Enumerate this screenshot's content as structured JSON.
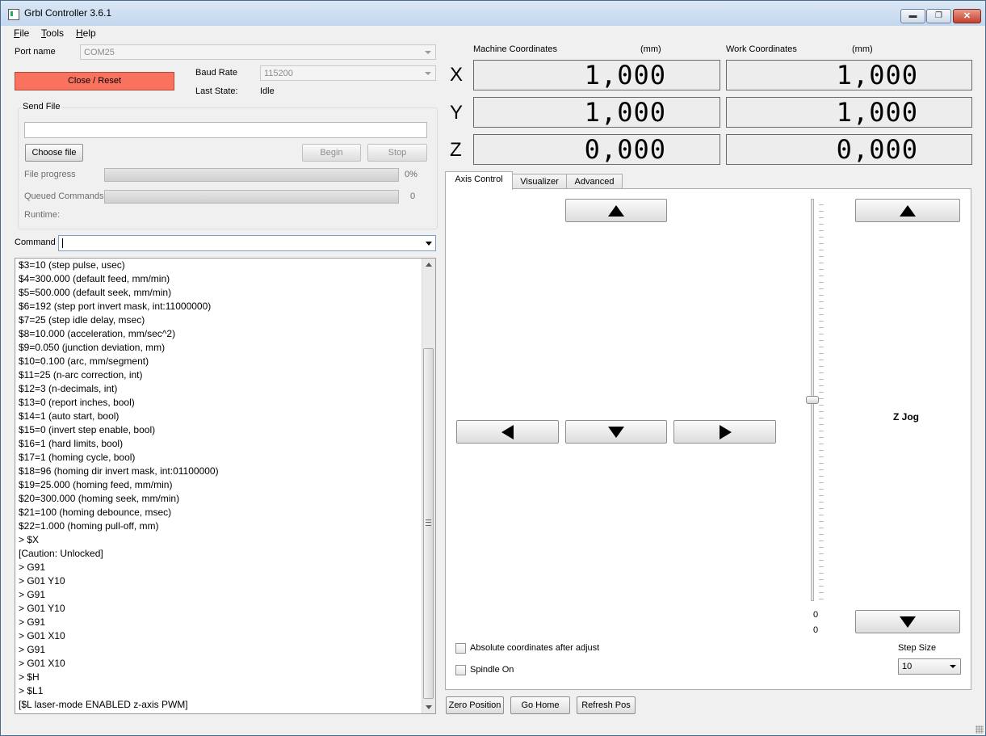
{
  "window": {
    "title": "Grbl Controller 3.6.1"
  },
  "menu": {
    "file": "File",
    "tools": "Tools",
    "help": "Help"
  },
  "connection": {
    "port_label": "Port name",
    "port_value": "COM25",
    "close_reset_label": "Close / Reset",
    "baud_label": "Baud Rate",
    "baud_value": "115200",
    "last_state_label": "Last State:",
    "last_state_value": "Idle"
  },
  "send_file": {
    "group_label": "Send File",
    "file_path": "",
    "choose_label": "Choose file",
    "begin_label": "Begin",
    "stop_label": "Stop",
    "progress_label": "File progress",
    "progress_value": "0%",
    "progress_fraction": 0,
    "queued_label": "Queued Commands",
    "queued_value": "0",
    "runtime_label": "Runtime:"
  },
  "command": {
    "label": "Command",
    "value": ""
  },
  "log": [
    "$3=10 (step pulse, usec)",
    "$4=300.000 (default feed, mm/min)",
    "$5=500.000 (default seek, mm/min)",
    "$6=192 (step port invert mask, int:11000000)",
    "$7=25 (step idle delay, msec)",
    "$8=10.000 (acceleration, mm/sec^2)",
    "$9=0.050 (junction deviation, mm)",
    "$10=0.100 (arc, mm/segment)",
    "$11=25 (n-arc correction, int)",
    "$12=3 (n-decimals, int)",
    "$13=0 (report inches, bool)",
    "$14=1 (auto start, bool)",
    "$15=0 (invert step enable, bool)",
    "$16=1 (hard limits, bool)",
    "$17=1 (homing cycle, bool)",
    "$18=96 (homing dir invert mask, int:01100000)",
    "$19=25.000 (homing feed, mm/min)",
    "$20=300.000 (homing seek, mm/min)",
    "$21=100 (homing debounce, msec)",
    "$22=1.000 (homing pull-off, mm)",
    "> $X",
    "[Caution: Unlocked]",
    "> G91",
    "> G01 Y10",
    "> G91",
    "> G01 Y10",
    "> G91",
    "> G01 X10",
    "> G91",
    "> G01 X10",
    "> $H",
    "> $L1",
    "[$L laser-mode ENABLED z-axis PWM]"
  ],
  "coordinates": {
    "machine_label": "Machine Coordinates",
    "work_label": "Work Coordinates",
    "unit": "(mm)",
    "axes": [
      "X",
      "Y",
      "Z"
    ],
    "machine": {
      "x": "1,000",
      "y": "1,000",
      "z": "0,000"
    },
    "work": {
      "x": "1,000",
      "y": "1,000",
      "z": "0,000"
    }
  },
  "tabs": {
    "axis_control": "Axis Control",
    "visualizer": "Visualizer",
    "advanced": "Advanced"
  },
  "axis_control": {
    "z_jog_label": "Z Jog",
    "slider_min": "0",
    "slider_value": "0",
    "absolute_coords_label": "Absolute coordinates after adjust",
    "spindle_label": "Spindle On",
    "step_size_label": "Step Size",
    "step_size_value": "10"
  },
  "bottom_buttons": {
    "zero": "Zero Position",
    "home": "Go Home",
    "refresh": "Refresh Pos"
  }
}
